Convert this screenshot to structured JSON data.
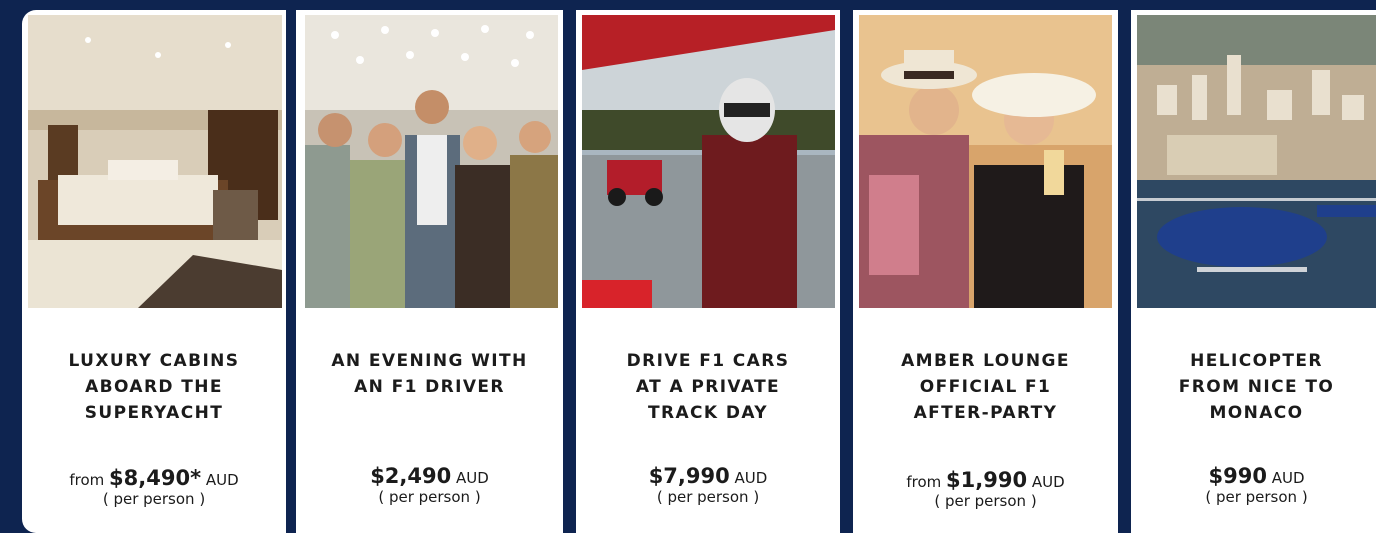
{
  "colors": {
    "background": "#0e2450",
    "card": "#ffffff",
    "text": "#1b1b1b"
  },
  "cards": [
    {
      "image": "superyacht-cabin-photo",
      "title_lines": [
        "LUXURY CABINS",
        "ABOARD THE",
        "SUPERYACHT"
      ],
      "prefix": "from",
      "amount": "$8,490*",
      "currency": "AUD",
      "per_person": "( per person )"
    },
    {
      "image": "f1-driver-evening-photo",
      "title_lines": [
        "AN EVENING WITH",
        "AN F1 DRIVER"
      ],
      "prefix": "",
      "amount": "$2,490",
      "currency": "AUD",
      "per_person": "( per person )"
    },
    {
      "image": "f1-track-day-photo",
      "title_lines": [
        "DRIVE F1 CARS",
        "AT A PRIVATE",
        "TRACK DAY"
      ],
      "prefix": "",
      "amount": "$7,990",
      "currency": "AUD",
      "per_person": "( per person )"
    },
    {
      "image": "amber-lounge-party-photo",
      "title_lines": [
        "AMBER LOUNGE",
        "OFFICIAL F1",
        "AFTER-PARTY"
      ],
      "prefix": "from",
      "amount": "$1,990",
      "currency": "AUD",
      "per_person": "( per person )"
    },
    {
      "image": "helicopter-monaco-photo",
      "title_lines": [
        "HELICOPTER",
        "FROM NICE TO",
        "MONACO"
      ],
      "prefix": "",
      "amount": "$990",
      "currency": "AUD",
      "per_person": "( per person )"
    }
  ]
}
